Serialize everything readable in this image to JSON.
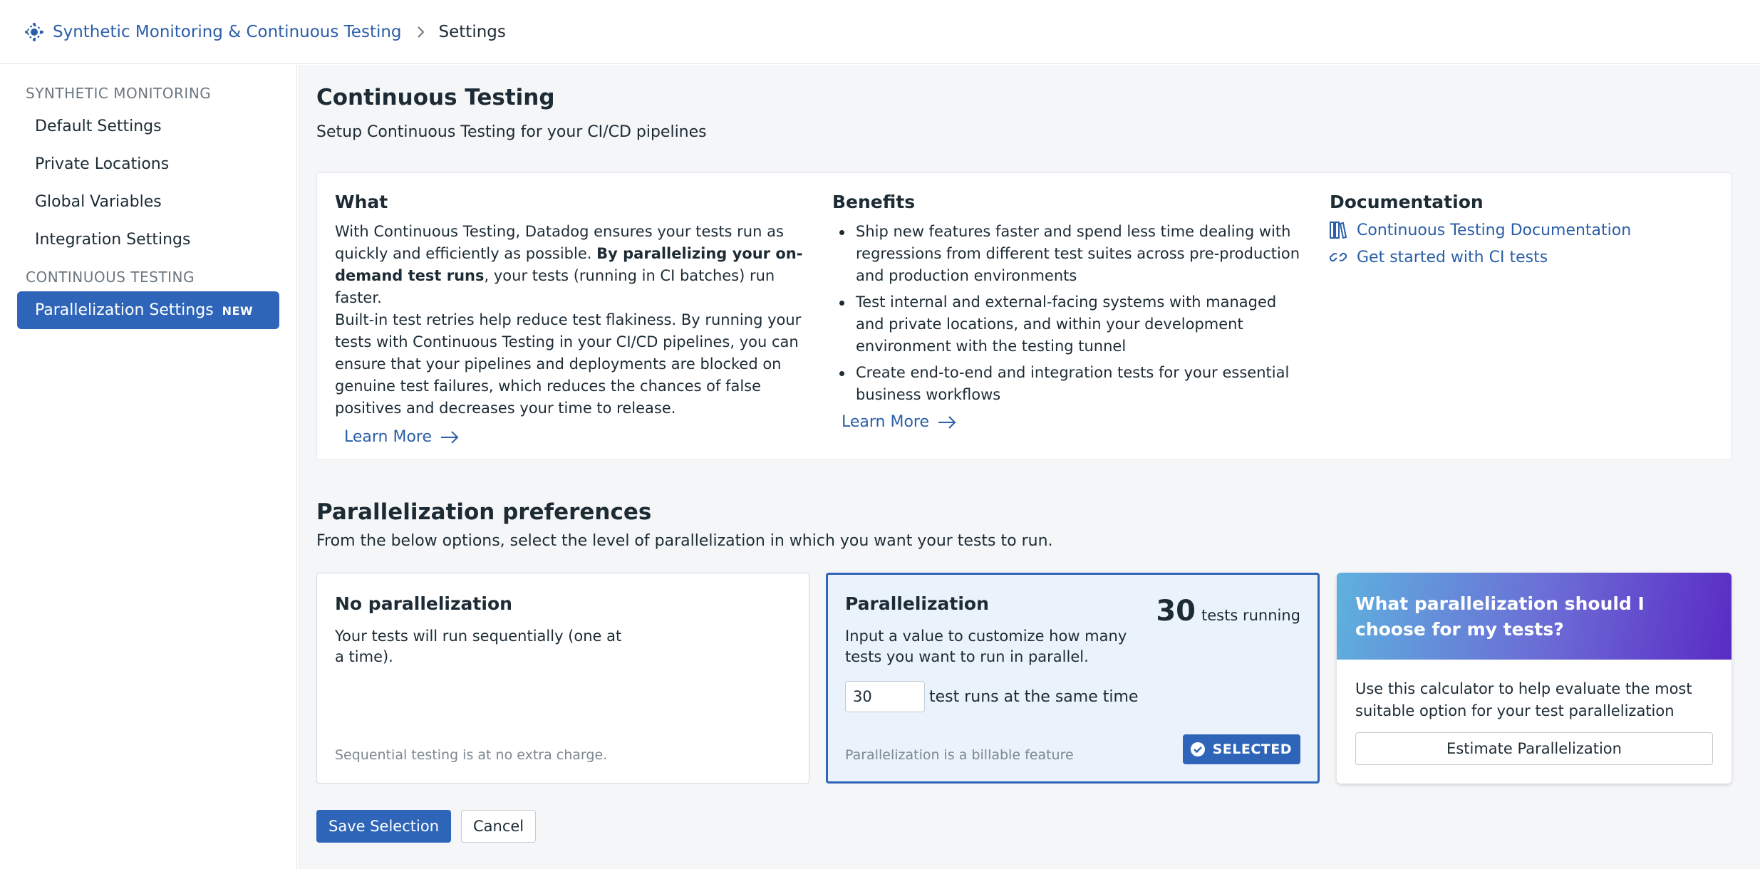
{
  "breadcrumb": {
    "app_icon": "synthetics-icon",
    "app_link": "Synthetic Monitoring & Continuous Testing",
    "current": "Settings"
  },
  "sidebar": {
    "section_synthetic": "SYNTHETIC MONITORING",
    "items_synthetic": [
      {
        "label": "Default Settings"
      },
      {
        "label": "Private Locations"
      },
      {
        "label": "Global Variables"
      },
      {
        "label": "Integration Settings"
      }
    ],
    "section_continuous": "CONTINUOUS TESTING",
    "active_item": {
      "label": "Parallelization Settings",
      "badge": "NEW"
    }
  },
  "main": {
    "title": "Continuous Testing",
    "subtitle": "Setup Continuous Testing for your CI/CD pipelines",
    "what": {
      "heading": "What",
      "p1_a": "With Continuous Testing, Datadog ensures your tests run as quickly and efficiently as possible. ",
      "p1_bold": "By parallelizing your on-demand test runs",
      "p1_b": ", your tests (running in CI batches) run faster.",
      "p2": "Built-in test retries help reduce test flakiness. By running your tests with Continuous Testing in your CI/CD pipelines, you can ensure that your pipelines and deployments are blocked on genuine test failures, which reduces the chances of false positives and decreases your time to release.",
      "learn_more": "Learn More"
    },
    "benefits": {
      "heading": "Benefits",
      "items": [
        "Ship new features faster and spend less time dealing with regressions from different test suites across pre-production and production environments",
        "Test internal and external-facing systems with managed and private locations, and within your development environment with the testing tunnel",
        "Create end-to-end and integration tests for your essential business workflows"
      ],
      "learn_more": "Learn More"
    },
    "documentation": {
      "heading": "Documentation",
      "links": [
        {
          "label": "Continuous Testing Documentation",
          "icon": "books-icon"
        },
        {
          "label": "Get started with CI tests",
          "icon": "link-icon"
        }
      ]
    },
    "preferences": {
      "title": "Parallelization preferences",
      "description": "From the below options, select the level of parallelization in which you want your tests to run.",
      "no_parallel": {
        "title": "No parallelization",
        "description": "Your tests will run sequentially (one at a time).",
        "footnote": "Sequential testing is at no extra charge."
      },
      "parallel": {
        "title": "Parallelization",
        "count": "30",
        "count_label": "tests running",
        "description": "Input a value to customize how many tests you want to run in parallel.",
        "input_value": "30",
        "input_suffix": "test runs at the same time",
        "footnote": "Parallelization is a billable feature",
        "selected_label": "SELECTED"
      },
      "help": {
        "title": "What parallelization should I choose for my tests?",
        "body": "Use this calculator to help evaluate the most suitable option for your test parallelization",
        "button": "Estimate Parallelization"
      }
    },
    "actions": {
      "save": "Save Selection",
      "cancel": "Cancel"
    }
  },
  "colors": {
    "accent": "#2e65b8",
    "link": "#2a5ea8",
    "selected_bg": "#eaf2fb"
  }
}
